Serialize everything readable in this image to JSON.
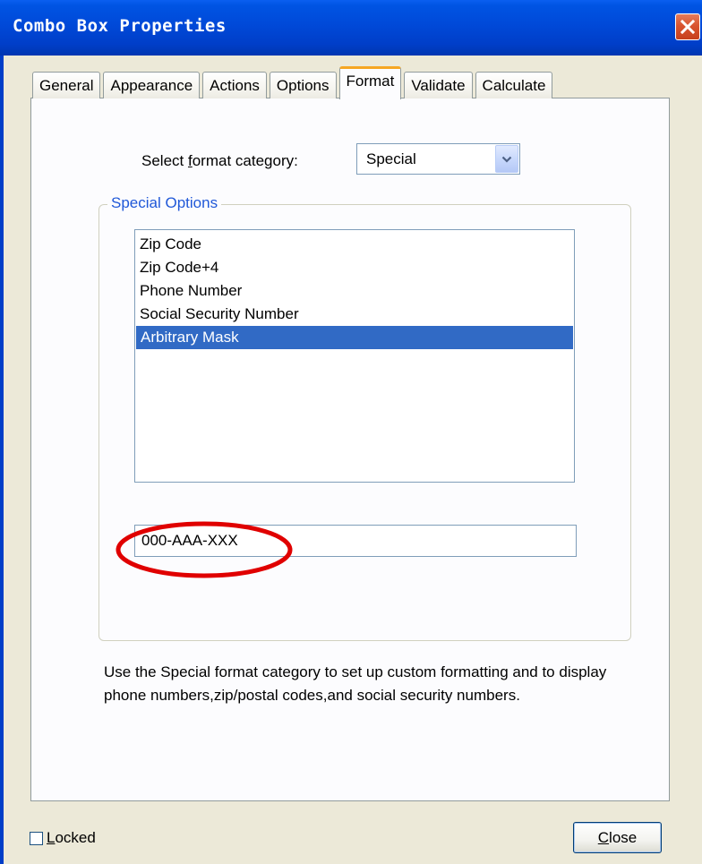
{
  "window": {
    "title": "Combo Box Properties"
  },
  "tabs": [
    {
      "label": "General"
    },
    {
      "label": "Appearance"
    },
    {
      "label": "Actions"
    },
    {
      "label": "Options"
    },
    {
      "label": "Format",
      "active": true
    },
    {
      "label": "Validate"
    },
    {
      "label": "Calculate"
    }
  ],
  "format": {
    "category_label_pre": "Select ",
    "category_label_underlined": "f",
    "category_label_post": "ormat category:",
    "category_value": "Special"
  },
  "special_options": {
    "legend": "Special Options",
    "items": [
      {
        "label": "Zip Code"
      },
      {
        "label": "Zip Code+4"
      },
      {
        "label": "Phone Number"
      },
      {
        "label": "Social Security Number"
      },
      {
        "label": "Arbitrary Mask",
        "selected": true
      }
    ],
    "mask_value": "000-AAA-XXX"
  },
  "help_text": "Use the Special format category to set up custom formatting and to display phone numbers,zip/postal codes,and social security numbers.",
  "footer": {
    "locked_label_underlined": "L",
    "locked_label_rest": "ocked",
    "locked_checked": false,
    "close_label_underlined": "C",
    "close_label_rest": "lose"
  },
  "colors": {
    "title_bar": "#0054e3",
    "selection": "#316ac5",
    "active_tab_accent": "#f6a623",
    "annotation": "#e00000",
    "group_legend": "#2058d8"
  }
}
